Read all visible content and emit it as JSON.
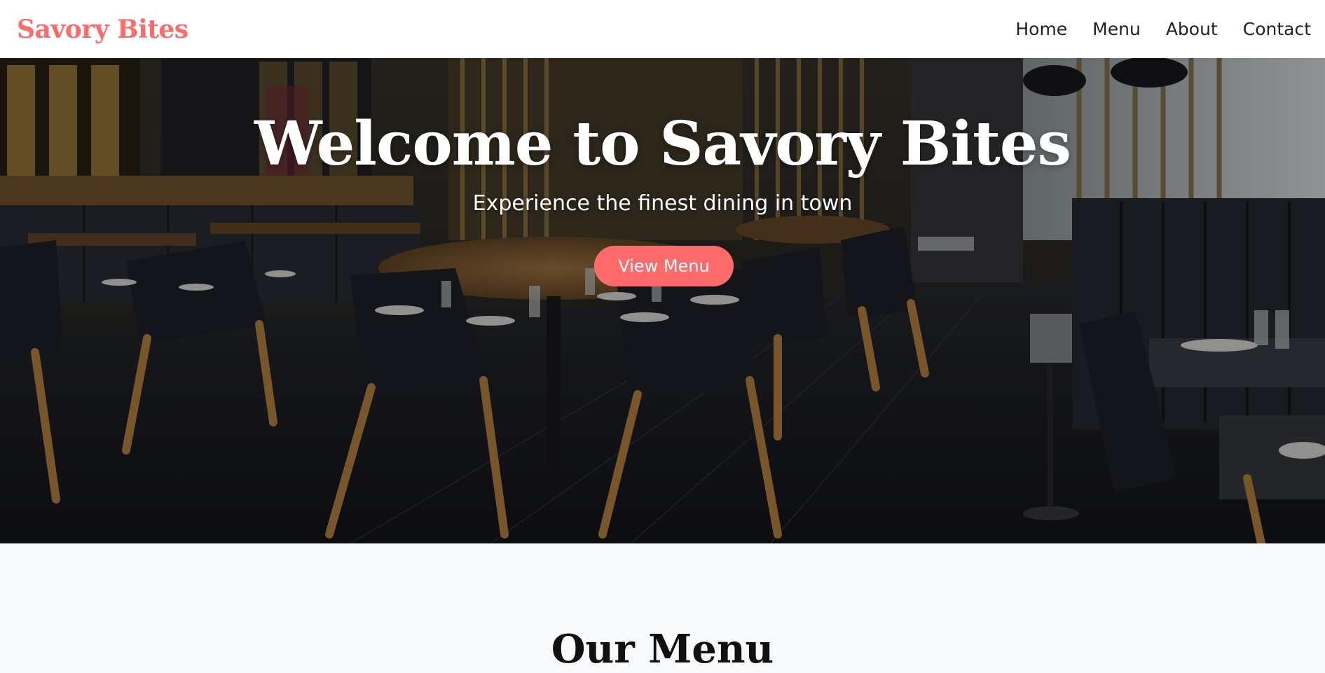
{
  "brand": "Savory Bites",
  "nav": {
    "links": [
      "Home",
      "Menu",
      "About",
      "Contact"
    ]
  },
  "hero": {
    "title": "Welcome to Savory Bites",
    "subtitle": "Experience the finest dining in town",
    "button_label": "View Menu"
  },
  "menu_section": {
    "heading": "Our Menu"
  },
  "colors": {
    "accent": "#ff6b6b",
    "nav_bg": "#ffffff",
    "section_bg": "#f8f9fb",
    "text_dark": "#111111"
  }
}
